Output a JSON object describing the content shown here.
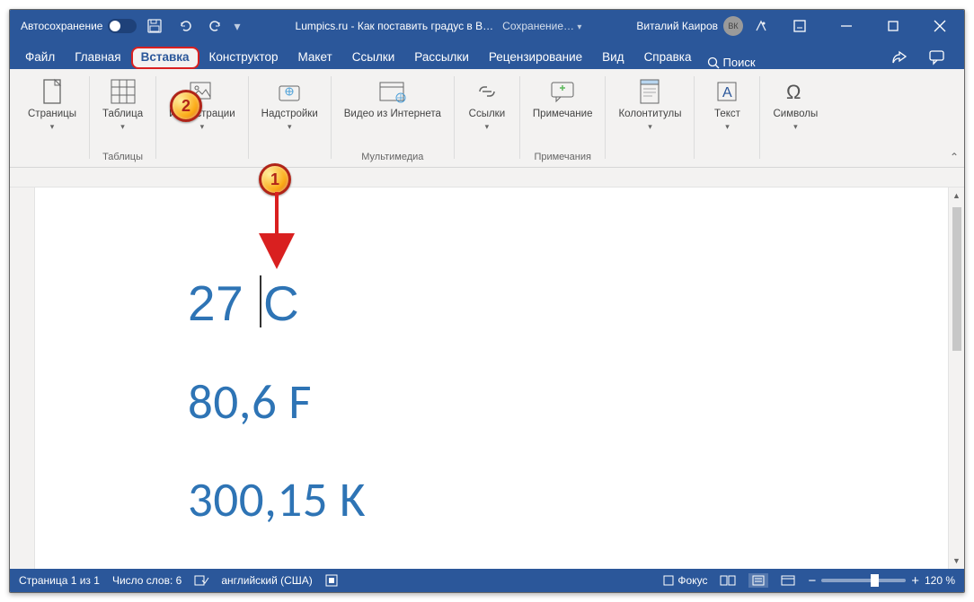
{
  "titlebar": {
    "autosave": "Автосохранение",
    "title": "Lumpics.ru - Как поставить градус в B…",
    "saving": "Сохранение…",
    "user": "Виталий Каиров",
    "initials": "ВК"
  },
  "tabs": {
    "file": "Файл",
    "home": "Главная",
    "insert": "Вставка",
    "design": "Конструктор",
    "layout": "Макет",
    "references": "Ссылки",
    "mailings": "Рассылки",
    "review": "Рецензирование",
    "view": "Вид",
    "help": "Справка",
    "search": "Поиск"
  },
  "ribbon": {
    "pages": "Страницы",
    "table": "Таблица",
    "tables_group": "Таблицы",
    "illustrations": "Иллюстрации",
    "addins": "Надстройки",
    "video": "Видео из Интернета",
    "media_group": "Мультимедиа",
    "links": "Ссылки",
    "comment": "Примечание",
    "comments_group": "Примечания",
    "headerfooter": "Колонтитулы",
    "text": "Текст",
    "symbols": "Символы"
  },
  "document": {
    "line1a": "27 ",
    "line1b": "C",
    "line2": "80,6 F",
    "line3": "300,15 K"
  },
  "status": {
    "page": "Страница 1 из 1",
    "words": "Число слов: 6",
    "lang": "английский (США)",
    "focus": "Фокус",
    "zoom": "120 %"
  },
  "annotations": {
    "b1": "1",
    "b2": "2"
  }
}
